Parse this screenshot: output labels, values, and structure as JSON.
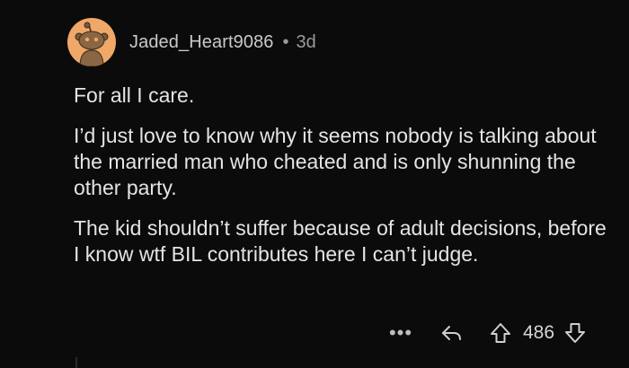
{
  "comment": {
    "author": "Jaded_Heart9086",
    "separator": "•",
    "age": "3d",
    "paragraphs": [
      "For all I care.",
      "I’d just love to know why it seems nobody is talking about the married man who cheated and is only shunning the other party.",
      "The kid shouldn’t suffer because of adult decisions, before I know wtf BIL contributes here I can’t judge."
    ],
    "more_label": "•••",
    "score": "486"
  },
  "icons": {
    "avatar": "snoo-avatar-icon",
    "reply": "reply-arrow-icon",
    "upvote": "upvote-arrow-icon",
    "downvote": "downvote-arrow-icon"
  },
  "colors": {
    "background": "#0b0b0b",
    "avatar_bg": "#f0a868",
    "text": "#e4e4e4",
    "muted": "#9a9a9a"
  }
}
